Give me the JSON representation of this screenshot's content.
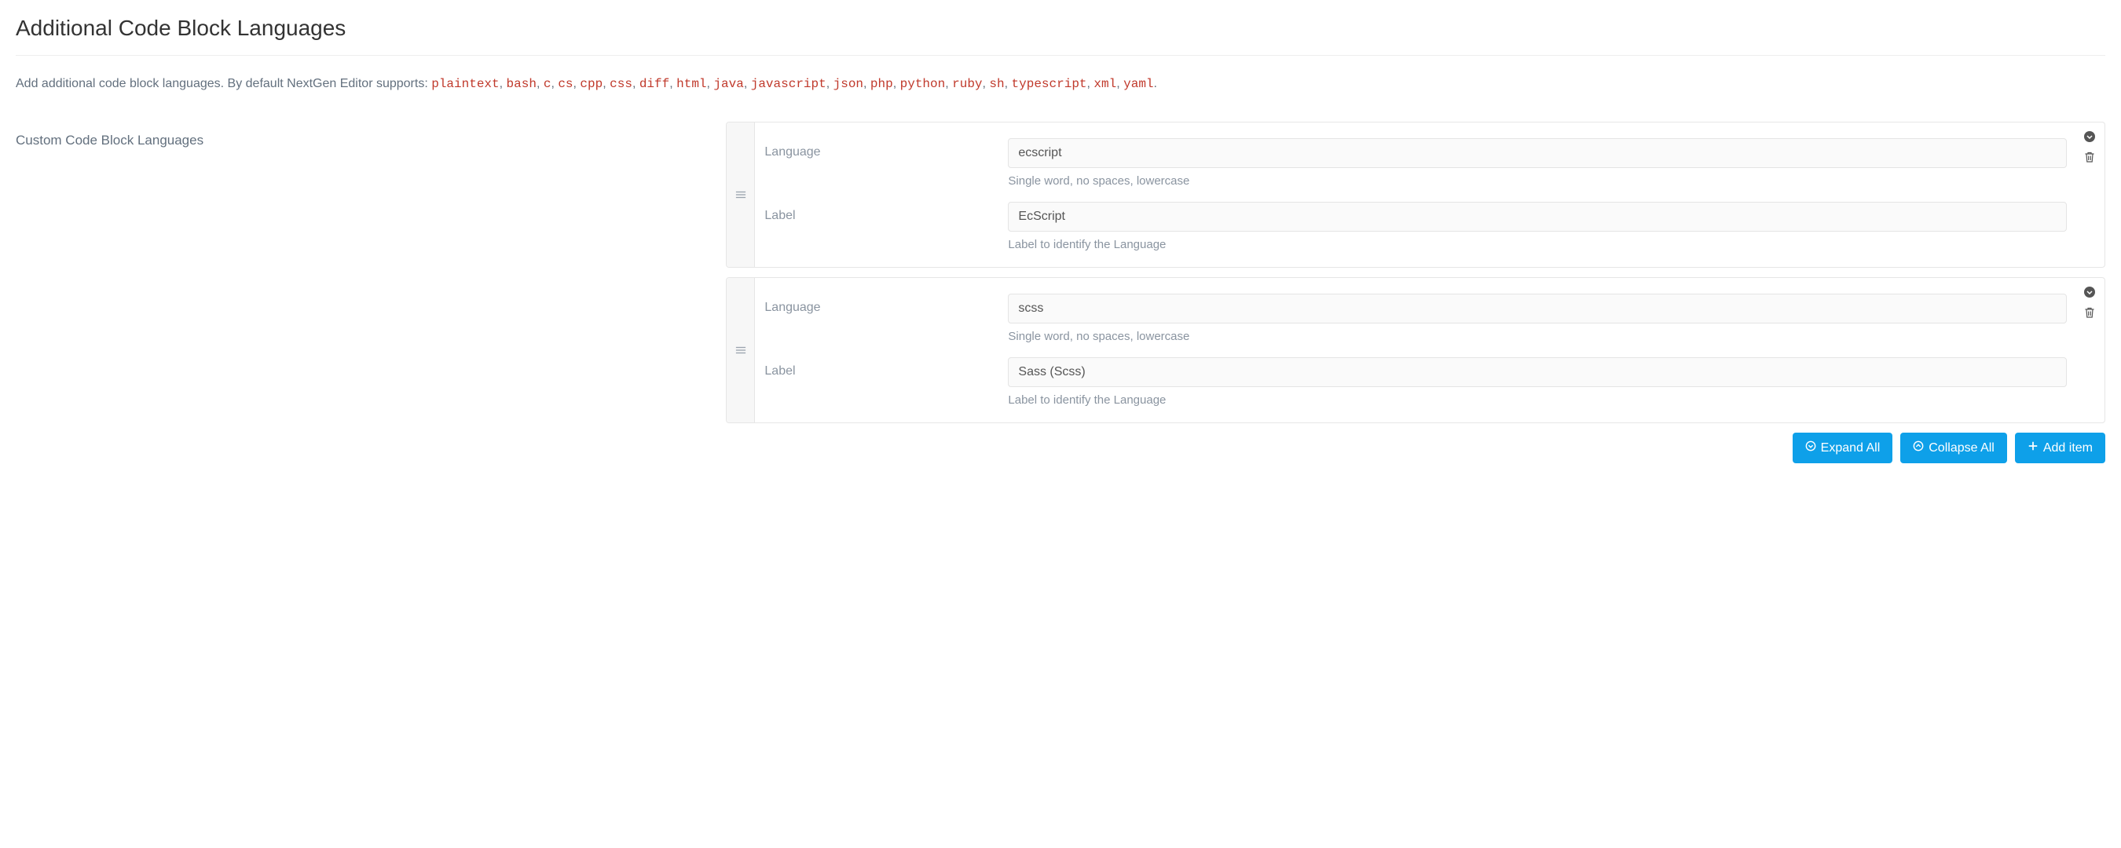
{
  "header": {
    "title": "Additional Code Block Languages"
  },
  "intro": {
    "prefix": "Add additional code block languages. By default NextGen Editor supports: ",
    "langs": [
      "plaintext",
      "bash",
      "c",
      "cs",
      "cpp",
      "css",
      "diff",
      "html",
      "java",
      "javascript",
      "json",
      "php",
      "python",
      "ruby",
      "sh",
      "typescript",
      "xml",
      "yaml"
    ],
    "suffix": "."
  },
  "form": {
    "section_label": "Custom Code Block Languages",
    "language_label": "Language",
    "language_help": "Single word, no spaces, lowercase",
    "label_label": "Label",
    "label_help": "Label to identify the Language"
  },
  "items": [
    {
      "language": "ecscript",
      "label": "EcScript"
    },
    {
      "language": "scss",
      "label": "Sass (Scss)"
    }
  ],
  "buttons": {
    "expand_all": "Expand All",
    "collapse_all": "Collapse All",
    "add_item": "Add item"
  }
}
